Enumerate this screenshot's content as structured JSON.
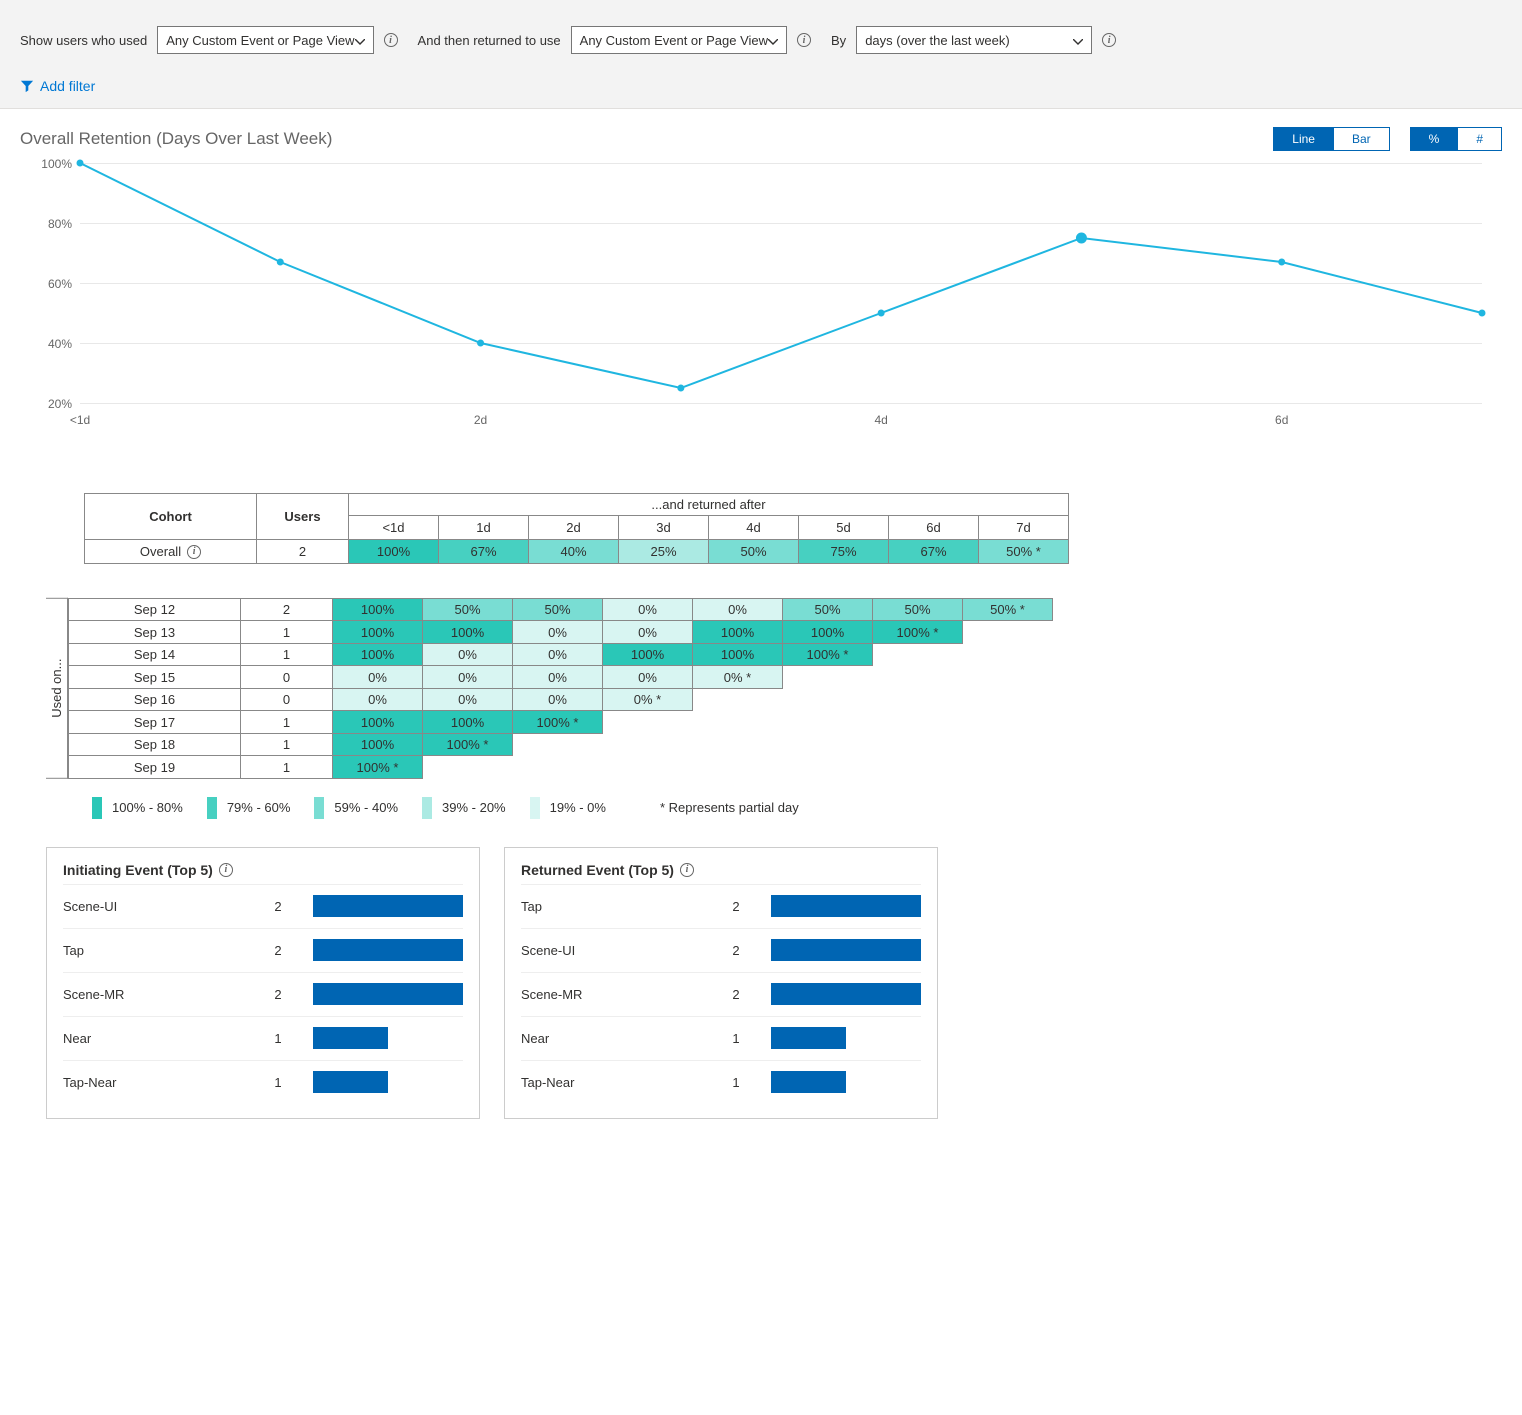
{
  "filter": {
    "label_show": "Show users who used",
    "select_initiate": "Any Custom Event or Page View",
    "label_return": "And then returned to use",
    "select_return": "Any Custom Event or Page View",
    "label_by": "By",
    "select_time": "days (over the last week)",
    "add_filter_label": "Add filter"
  },
  "chart_header": {
    "title": "Overall Retention (Days Over Last Week)",
    "view_toggle": {
      "line": "Line",
      "bar": "Bar",
      "active": "Line"
    },
    "metric_toggle": {
      "pct": "%",
      "num": "#",
      "active": "%"
    }
  },
  "chart_data": {
    "type": "line",
    "title": "Overall Retention (Days Over Last Week)",
    "xlabel": "",
    "ylabel": "",
    "ylim": [
      20,
      100
    ],
    "y_ticks": [
      "20%",
      "40%",
      "60%",
      "80%",
      "100%"
    ],
    "x_ticks": [
      "<1d",
      "2d",
      "4d",
      "6d"
    ],
    "categories": [
      "<1d",
      "1d",
      "2d",
      "3d",
      "4d",
      "5d",
      "6d",
      "7d"
    ],
    "values": [
      100,
      67,
      40,
      25,
      50,
      75,
      67,
      50
    ]
  },
  "cohort": {
    "cohort_header": "Cohort",
    "users_header": "Users",
    "return_header": "...and returned after",
    "day_headers": [
      "<1d",
      "1d",
      "2d",
      "3d",
      "4d",
      "5d",
      "6d",
      "7d"
    ],
    "overall_label": "Overall",
    "overall_users": "2",
    "overall_values": [
      "100%",
      "67%",
      "40%",
      "25%",
      "50%",
      "75%",
      "67%",
      "50% *"
    ],
    "overall_bands": [
      "b100",
      "b80",
      "b60",
      "b40",
      "b60",
      "b80",
      "b80",
      "b60"
    ]
  },
  "daily": {
    "side_label": "Used on...",
    "rows": [
      {
        "date": "Sep 12",
        "users": "2",
        "cells": [
          {
            "v": "100%",
            "b": "b100"
          },
          {
            "v": "50%",
            "b": "b60"
          },
          {
            "v": "50%",
            "b": "b60"
          },
          {
            "v": "0%",
            "b": "b20"
          },
          {
            "v": "0%",
            "b": "b20"
          },
          {
            "v": "50%",
            "b": "b60"
          },
          {
            "v": "50%",
            "b": "b60"
          },
          {
            "v": "50% *",
            "b": "b60"
          }
        ]
      },
      {
        "date": "Sep 13",
        "users": "1",
        "cells": [
          {
            "v": "100%",
            "b": "b100"
          },
          {
            "v": "100%",
            "b": "b100"
          },
          {
            "v": "0%",
            "b": "b20"
          },
          {
            "v": "0%",
            "b": "b20"
          },
          {
            "v": "100%",
            "b": "b100"
          },
          {
            "v": "100%",
            "b": "b100"
          },
          {
            "v": "100% *",
            "b": "b100"
          }
        ]
      },
      {
        "date": "Sep 14",
        "users": "1",
        "cells": [
          {
            "v": "100%",
            "b": "b100"
          },
          {
            "v": "0%",
            "b": "b20"
          },
          {
            "v": "0%",
            "b": "b20"
          },
          {
            "v": "100%",
            "b": "b100"
          },
          {
            "v": "100%",
            "b": "b100"
          },
          {
            "v": "100% *",
            "b": "b100"
          }
        ]
      },
      {
        "date": "Sep 15",
        "users": "0",
        "cells": [
          {
            "v": "0%",
            "b": "b20"
          },
          {
            "v": "0%",
            "b": "b20"
          },
          {
            "v": "0%",
            "b": "b20"
          },
          {
            "v": "0%",
            "b": "b20"
          },
          {
            "v": "0% *",
            "b": "b20"
          }
        ]
      },
      {
        "date": "Sep 16",
        "users": "0",
        "cells": [
          {
            "v": "0%",
            "b": "b20"
          },
          {
            "v": "0%",
            "b": "b20"
          },
          {
            "v": "0%",
            "b": "b20"
          },
          {
            "v": "0% *",
            "b": "b20"
          }
        ]
      },
      {
        "date": "Sep 17",
        "users": "1",
        "cells": [
          {
            "v": "100%",
            "b": "b100"
          },
          {
            "v": "100%",
            "b": "b100"
          },
          {
            "v": "100% *",
            "b": "b100"
          }
        ]
      },
      {
        "date": "Sep 18",
        "users": "1",
        "cells": [
          {
            "v": "100%",
            "b": "b100"
          },
          {
            "v": "100% *",
            "b": "b100"
          }
        ]
      },
      {
        "date": "Sep 19",
        "users": "1",
        "cells": [
          {
            "v": "100% *",
            "b": "b100"
          }
        ]
      }
    ]
  },
  "legend": {
    "items": [
      {
        "label": "100% - 80%",
        "band": "b100"
      },
      {
        "label": "79% - 60%",
        "band": "b80"
      },
      {
        "label": "59% - 40%",
        "band": "b60"
      },
      {
        "label": "39% - 20%",
        "band": "b40"
      },
      {
        "label": "19% - 0%",
        "band": "b20"
      }
    ],
    "note": "* Represents partial day"
  },
  "panels": {
    "initiating": {
      "title": "Initiating Event (Top 5)",
      "max": 2,
      "rows": [
        {
          "name": "Scene-UI",
          "count": 2
        },
        {
          "name": "Tap",
          "count": 2
        },
        {
          "name": "Scene-MR",
          "count": 2
        },
        {
          "name": "Near",
          "count": 1
        },
        {
          "name": "Tap-Near",
          "count": 1
        }
      ]
    },
    "returned": {
      "title": "Returned Event (Top 5)",
      "max": 2,
      "rows": [
        {
          "name": "Tap",
          "count": 2
        },
        {
          "name": "Scene-UI",
          "count": 2
        },
        {
          "name": "Scene-MR",
          "count": 2
        },
        {
          "name": "Near",
          "count": 1
        },
        {
          "name": "Tap-Near",
          "count": 1
        }
      ]
    }
  }
}
